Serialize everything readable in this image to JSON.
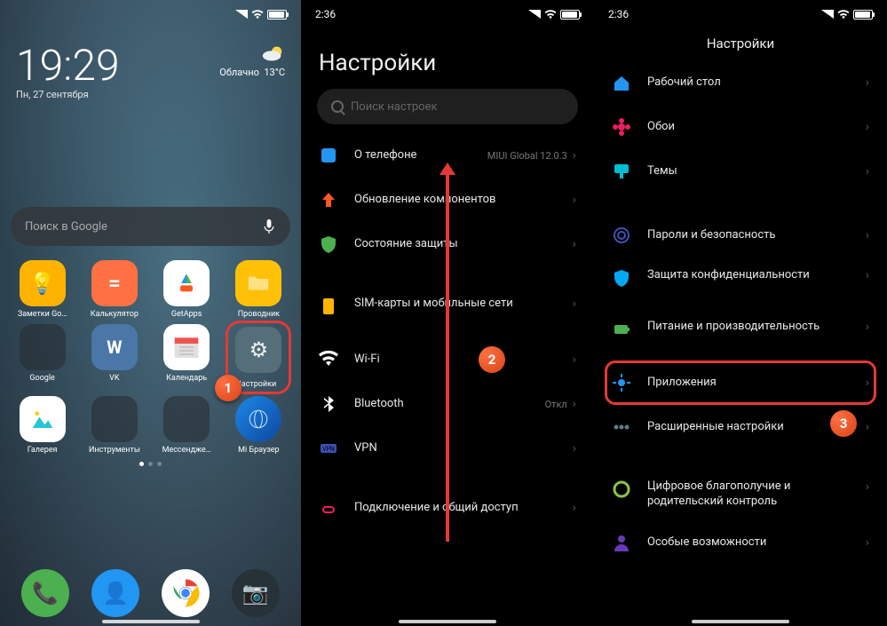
{
  "screen1": {
    "clock": "19:29",
    "date": "Пн, 27 сентября",
    "weather_cond": "Облачно",
    "weather_temp": "13°C",
    "search_placeholder": "Поиск в Google",
    "apps": [
      {
        "label": "Заметки Go…",
        "bg": "#ffb300",
        "glyph": "◉"
      },
      {
        "label": "Калькулятор",
        "bg": "#ff7043",
        "glyph": "="
      },
      {
        "label": "GetApps",
        "bg": "#fff",
        "glyph": "▲"
      },
      {
        "label": "Проводник",
        "bg": "#ffc107",
        "glyph": "▭"
      },
      {
        "label": "Google",
        "folder": true
      },
      {
        "label": "VK",
        "bg": "#4a76a8",
        "glyph": "w"
      },
      {
        "label": "Календарь",
        "bg": "#fff",
        "glyph": "▦"
      },
      {
        "label": "Настройки",
        "bg": "#607d8b",
        "glyph": "⚙",
        "highlight": true
      },
      {
        "label": "Галерея",
        "bg": "#fff",
        "glyph": "◢"
      },
      {
        "label": "Инструменты",
        "folder": true
      },
      {
        "label": "Мессендже…",
        "folder": true
      },
      {
        "label": "Mi Браузер",
        "bg": "#1e88e5",
        "glyph": "●"
      }
    ],
    "step": "1"
  },
  "screen2": {
    "time": "2:36",
    "title": "Настройки",
    "search_placeholder": "Поиск настроек",
    "items": [
      {
        "label": "О телефоне",
        "sub": "MIUI Global 12.0.3",
        "color": "#2196f3",
        "shape": "sq"
      },
      {
        "label": "Обновление компонентов",
        "color": "#ff5722",
        "shape": "up"
      },
      {
        "label": "Состояние защиты",
        "color": "#4caf50",
        "shape": "shield"
      },
      {
        "gap": true
      },
      {
        "label": "SIM-карты и мобильные сети",
        "color": "#ffb300",
        "shape": "sim",
        "tall": true
      },
      {
        "label": "Wi-Fi",
        "color": "#fff",
        "shape": "wifi"
      },
      {
        "label": "Bluetooth",
        "sub": "Откл",
        "color": "#fff",
        "shape": "bt"
      },
      {
        "label": "VPN",
        "color": "#3f51b5",
        "shape": "vpn"
      },
      {
        "gap": true
      },
      {
        "label": "Подключение и общий доступ",
        "color": "#e91e63",
        "shape": "link",
        "tall": true
      }
    ],
    "step": "2"
  },
  "screen3": {
    "time": "2:36",
    "title": "Настройки",
    "items": [
      {
        "label": "Рабочий стол",
        "color": "#2196f3",
        "shape": "home"
      },
      {
        "label": "Обои",
        "color": "#e91e63",
        "shape": "flower"
      },
      {
        "label": "Темы",
        "color": "#00bcd4",
        "shape": "brush"
      },
      {
        "gap": true
      },
      {
        "label": "Пароли и безопасность",
        "color": "#3f51b5",
        "shape": "finger"
      },
      {
        "label": "Защита конфиденциальности",
        "color": "#03a9f4",
        "shape": "shield",
        "tall": true
      },
      {
        "label": "Питание и производительность",
        "color": "#4caf50",
        "shape": "batt",
        "tall": true
      },
      {
        "label": "Приложения",
        "color": "#2196f3",
        "shape": "gear",
        "highlight": true
      },
      {
        "label": "Расширенные настройки",
        "color": "#607d8b",
        "shape": "dots"
      },
      {
        "gap": true
      },
      {
        "label": "Цифровое благополучие и родительский контроль",
        "color": "#8bc34a",
        "shape": "circle",
        "tall": true
      },
      {
        "label": "Особые возможности",
        "color": "#673ab7",
        "shape": "person"
      }
    ],
    "step": "3"
  }
}
